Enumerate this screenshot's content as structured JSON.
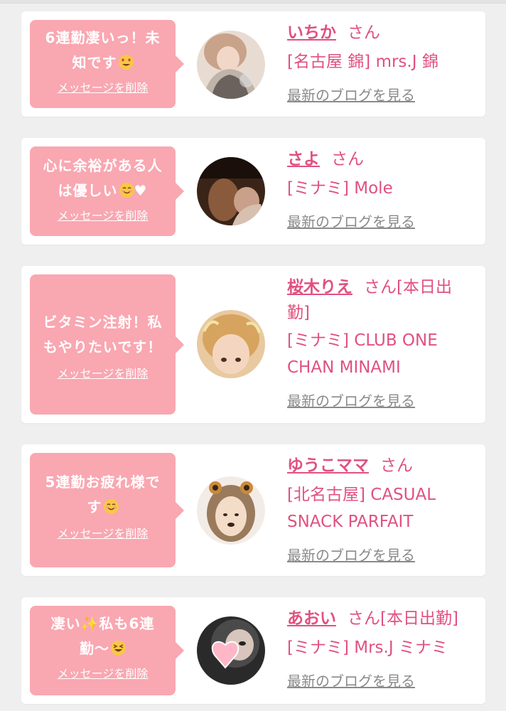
{
  "delete_label": "メッセージを削除",
  "blog_label": "最新のブログを見る",
  "honorific": "さん",
  "cards": [
    {
      "message_line1": "6連勤凄いっ！未",
      "message_line2": "知です",
      "message_emoji": "heart-eyes-emoji",
      "name": "いちか",
      "name_suffix": "さん",
      "shop_line1": "[名古屋 錦] mrs.J 錦",
      "shop_line2": ""
    },
    {
      "message_line1": "心に余裕がある人",
      "message_line2": "は優しい",
      "message_emoji": "smile-emoji-and-heart",
      "name": "さよ",
      "name_suffix": "さん",
      "shop_line1": "[ミナミ] Mole",
      "shop_line2": ""
    },
    {
      "message_line1": "ビタミン注射！私",
      "message_line2": "もやりたいです！",
      "message_emoji": "",
      "name": "桜木りえ",
      "name_suffix": "さん[本日出",
      "name_suffix2": "勤]",
      "shop_line1": "[ミナミ] CLUB ONE",
      "shop_line2": "CHAN MINAMI"
    },
    {
      "message_line1": "5連勤お疲れ様で",
      "message_line2": "す",
      "message_emoji": "smile-emoji",
      "name": "ゆうこママ",
      "name_suffix": "さん",
      "shop_line1": "[北名古屋] CASUAL",
      "shop_line2": "SNACK PARFAIT"
    },
    {
      "message_line1": "凄い",
      "message_line1b": "私も6連",
      "message_line2": "勤〜",
      "message_emoji": "sparkles-and-laughing-emoji",
      "name": "あおい",
      "name_suffix": "さん[本日出勤]",
      "shop_line1": "[ミナミ] Mrs.J ミナミ",
      "shop_line2": ""
    }
  ]
}
